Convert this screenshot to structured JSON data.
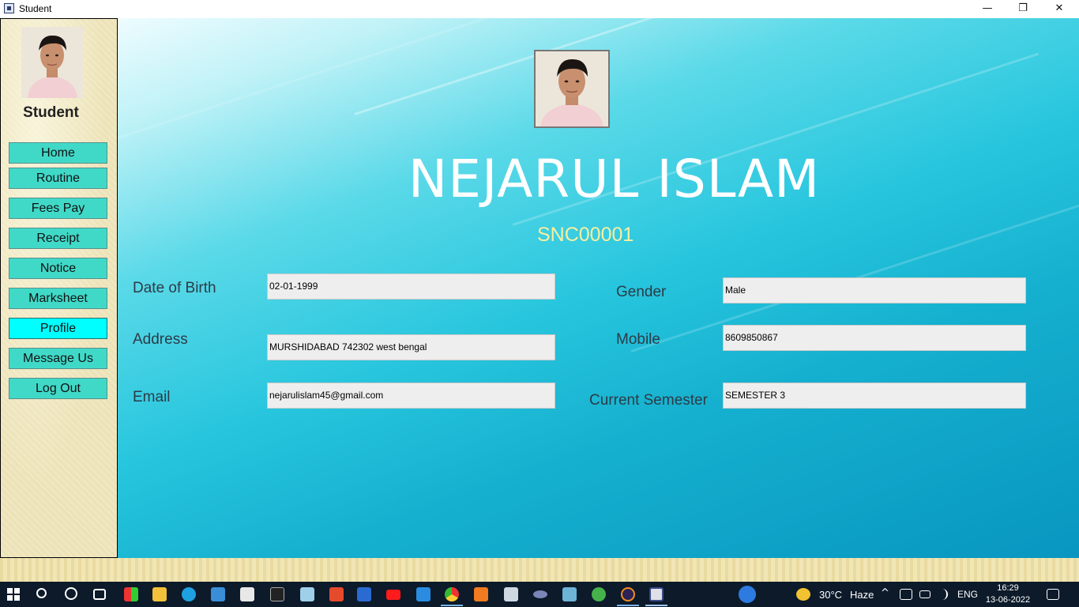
{
  "window": {
    "title": "Student",
    "minimize_glyph": "—",
    "maximize_glyph": "❐",
    "close_glyph": "✕"
  },
  "sidebar": {
    "title": "Student",
    "items": [
      {
        "label": "Home"
      },
      {
        "label": "Routine"
      },
      {
        "label": "Fees Pay"
      },
      {
        "label": "Receipt"
      },
      {
        "label": "Notice"
      },
      {
        "label": "Marksheet"
      },
      {
        "label": "Profile"
      },
      {
        "label": "Message Us"
      },
      {
        "label": "Log Out"
      }
    ],
    "active_item": "Profile"
  },
  "profile": {
    "name": "NEJARUL ISLAM",
    "student_id": "SNC00001",
    "fields": {
      "dob": {
        "label": "Date of Birth",
        "value": "02-01-1999"
      },
      "address": {
        "label": "Address",
        "value": "MURSHIDABAD 742302 west bengal"
      },
      "email": {
        "label": "Email",
        "value": "nejarulislam45@gmail.com"
      },
      "gender": {
        "label": "Gender",
        "value": "Male"
      },
      "mobile": {
        "label": "Mobile",
        "value": "8609850867"
      },
      "semester": {
        "label": "Current Semester",
        "value": "SEMESTER 3"
      }
    }
  },
  "taskbar": {
    "weather_temp": "30°C",
    "weather_desc": "Haze",
    "language": "ENG",
    "time": "16:29",
    "date": "13-06-2022",
    "icons": [
      "windows-start-icon",
      "search-icon",
      "cortana-icon",
      "task-view-icon",
      "colorful-app-icon",
      "file-explorer-icon",
      "edge-icon",
      "remote-desktop-icon",
      "mail-icon",
      "cmd-icon",
      "notepad-icon",
      "office-icon",
      "word-icon",
      "youtube-icon",
      "vscode-icon",
      "chrome-icon",
      "xampp-icon",
      "sql-icon",
      "php-icon",
      "python-icon",
      "utorrent-icon",
      "eclipse-icon",
      "java-app-icon"
    ]
  },
  "colors": {
    "nav_button": "#40d9c8",
    "nav_button_active": "#00ffff",
    "name_text": "#ffffff",
    "id_text": "#f7f0a0"
  }
}
